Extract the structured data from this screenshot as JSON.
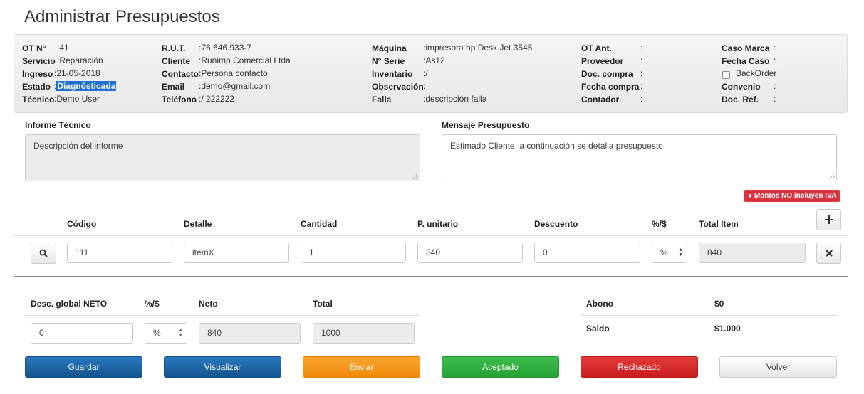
{
  "page": {
    "title": "Administrar Presupuestos"
  },
  "info": {
    "col1": [
      {
        "key": "OT N°",
        "value": ":41"
      },
      {
        "key": "Servicio",
        "value": ":Reparación"
      },
      {
        "key": "Ingreso",
        "value": ":21-05-2018"
      },
      {
        "key": "Estado",
        "value_prefix": ":",
        "value": "Diagnósticada"
      },
      {
        "key": "Técnico",
        "value": ":Demo User"
      }
    ],
    "col2": [
      {
        "key": "R.U.T.",
        "value": ":76.646.933-7"
      },
      {
        "key": "Cliente",
        "value": ":Runimp Comercial Ltda"
      },
      {
        "key": "Contacto",
        "value": ":Persona contacto"
      },
      {
        "key": "Email",
        "value": ":demo@gmail.com"
      },
      {
        "key": "Teléfono",
        "value": ":/ 222222"
      }
    ],
    "col3": [
      {
        "key": "Máquina",
        "value": ":impresora hp Desk Jet 3545"
      },
      {
        "key": "N° Serie",
        "value": ":As12"
      },
      {
        "key": "Inventario",
        "value": ":/"
      },
      {
        "key": "Observación",
        "value": ":"
      },
      {
        "key": "Falla",
        "value": ":descripción falla"
      }
    ],
    "col4": [
      {
        "key": "OT Ant.",
        "value": ":"
      },
      {
        "key": "Proveedor",
        "value": ":"
      },
      {
        "key": "Doc. compra",
        "value": ":"
      },
      {
        "key": "Fecha compra",
        "value": ":"
      },
      {
        "key": "Contador",
        "value": ":"
      }
    ],
    "col5": [
      {
        "key": "Caso Marca",
        "value": ":"
      },
      {
        "key": "Fecha Caso",
        "value": ":"
      },
      {
        "key": "BackOrder",
        "value": ""
      },
      {
        "key": "Convenio",
        "value": ":"
      },
      {
        "key": "Doc. Ref.",
        "value": ":"
      }
    ]
  },
  "informe": {
    "label": "Informe Técnico",
    "text": "Descripción del informe"
  },
  "mensaje": {
    "label": "Mensaje Presupuesto",
    "text": "Estimado Cliente, a continuación se detalla presupuesto"
  },
  "badge": {
    "text": "Montos NO incluyen IVA",
    "icon": "exclamation-circle-icon",
    "color": "#d9333f"
  },
  "items": {
    "headers": [
      "Código",
      "Detalle",
      "Cantidad",
      "P. unitario",
      "Descuento",
      "%/$",
      "Total Item"
    ],
    "rows": [
      {
        "codigo": "111",
        "detalle": "itemX",
        "cantidad": "1",
        "punitario": "840",
        "descuento": "0",
        "tipo": "%",
        "total": "840"
      }
    ]
  },
  "totals": {
    "headers": [
      "Desc. global NETO",
      "%/$",
      "Neto",
      "Total"
    ],
    "desc_global": "0",
    "tipo": "%",
    "neto": "840",
    "total": "1000"
  },
  "summary": [
    {
      "label": "Abono",
      "value": "$0"
    },
    {
      "label": "Saldo",
      "value": "$1.000"
    }
  ],
  "buttons": {
    "guardar": "Guardar",
    "visualizar": "Visualizar",
    "enviar": "Enviar",
    "aceptado": "Aceptado",
    "rechazado": "Rechazado",
    "volver": "Volver"
  },
  "colors": {
    "primary": "#1c65a8",
    "warning": "#f39a1f",
    "success": "#30b03e",
    "danger": "#d42a2a"
  }
}
